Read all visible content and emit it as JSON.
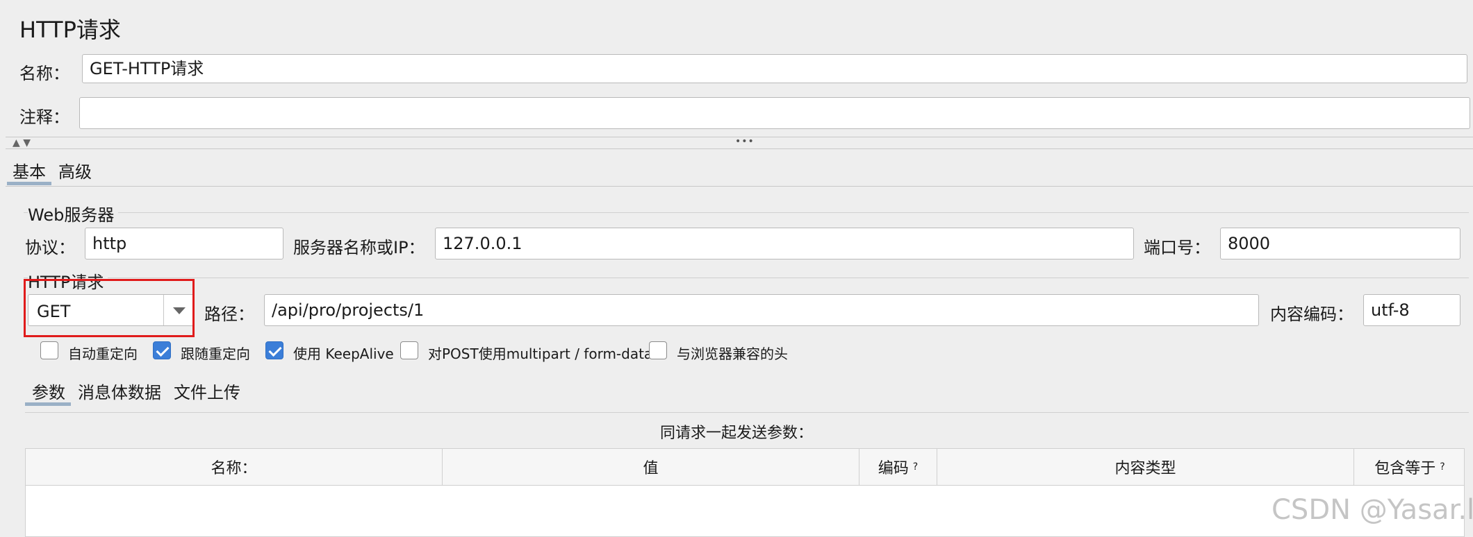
{
  "header": {
    "title": "HTTP请求"
  },
  "name_field": {
    "label": "名称：",
    "value": "GET-HTTP请求"
  },
  "comment_field": {
    "label": "注释：",
    "value": ""
  },
  "splitter": {
    "dots": "•••"
  },
  "tabs": [
    {
      "label": "基本"
    },
    {
      "label": "高级"
    }
  ],
  "web_server": {
    "group_title": "Web服务器",
    "protocol": {
      "label": "协议：",
      "value": "http"
    },
    "server": {
      "label": "服务器名称或IP：",
      "value": "127.0.0.1"
    },
    "port": {
      "label": "端口号：",
      "value": "8000"
    }
  },
  "http_request": {
    "group_title": "HTTP请求",
    "method": {
      "value": "GET"
    },
    "path": {
      "label": "路径：",
      "value": "/api/pro/projects/1"
    },
    "encoding": {
      "label": "内容编码：",
      "value": "utf-8"
    },
    "highlight_color": "#e01b1b"
  },
  "options": [
    {
      "label": "自动重定向",
      "checked": false
    },
    {
      "label": "跟随重定向",
      "checked": true
    },
    {
      "label": "使用 KeepAlive",
      "checked": true
    },
    {
      "label": "对POST使用multipart / form-data",
      "checked": false
    },
    {
      "label": "与浏览器兼容的头",
      "checked": false
    }
  ],
  "param_tabs": [
    {
      "label": "参数"
    },
    {
      "label": "消息体数据"
    },
    {
      "label": "文件上传"
    }
  ],
  "params": {
    "caption": "同请求一起发送参数：",
    "columns": [
      {
        "label": "名称："
      },
      {
        "label": "值"
      },
      {
        "label": "编码",
        "help": "?"
      },
      {
        "label": "内容类型"
      },
      {
        "label": "包含等于",
        "help": "?"
      }
    ]
  },
  "watermark": "CSDN @Yasar.l"
}
